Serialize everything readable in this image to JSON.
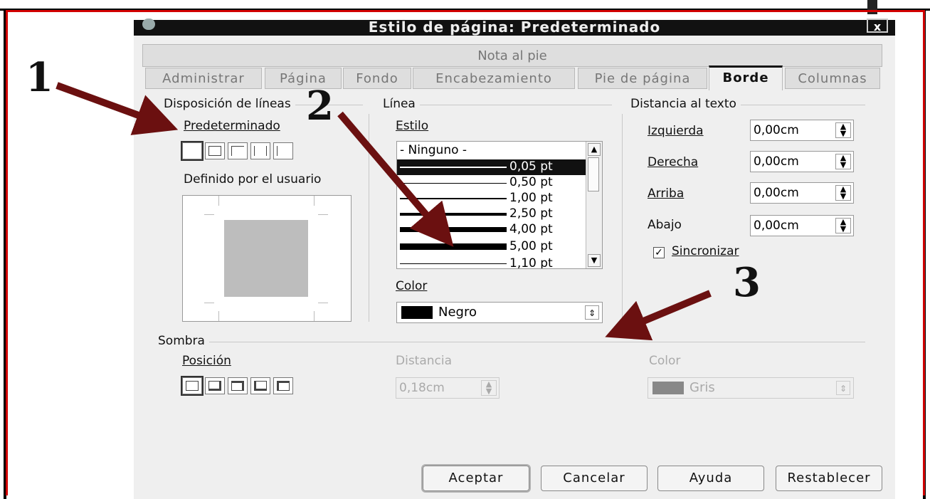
{
  "dialog": {
    "title": "Estilo de página: Predeterminado",
    "close": "x"
  },
  "tabs": {
    "top_row": "Nota al pie",
    "items": [
      {
        "label": "Administrar"
      },
      {
        "label": "Página"
      },
      {
        "label": "Fondo"
      },
      {
        "label": "Encabezamiento"
      },
      {
        "label": "Pie de página"
      },
      {
        "label": "Borde"
      },
      {
        "label": "Columnas"
      }
    ],
    "active": "Borde"
  },
  "line_arrangement": {
    "heading": "Disposición de líneas",
    "default_label": "Predeterminado",
    "user_label": "Definido por el usuario"
  },
  "line": {
    "heading": "Línea",
    "style_label": "Estilo",
    "styles": [
      {
        "label": "- Ninguno -"
      },
      {
        "label": "0,05 pt"
      },
      {
        "label": "0,50 pt"
      },
      {
        "label": "1,00 pt"
      },
      {
        "label": "2,50 pt"
      },
      {
        "label": "4,00 pt"
      },
      {
        "label": "5,00 pt"
      },
      {
        "label": "1,10 pt"
      }
    ],
    "selected_style": "0,05 pt",
    "color_label": "Color",
    "color_value": "Negro",
    "color_swatch": "#000000"
  },
  "spacing": {
    "heading": "Distancia al texto",
    "left_label": "Izquierda",
    "left_value": "0,00cm",
    "right_label": "Derecha",
    "right_value": "0,00cm",
    "top_label": "Arriba",
    "top_value": "0,00cm",
    "bottom_label": "Abajo",
    "bottom_value": "0,00cm",
    "sync_label": "Sincronizar",
    "sync_checked": true
  },
  "shadow": {
    "heading": "Sombra",
    "position_label": "Posición",
    "distance_label": "Distancia",
    "distance_value": "0,18cm",
    "color_label": "Color",
    "color_value": "Gris",
    "color_swatch": "#888888"
  },
  "buttons": {
    "ok": "Aceptar",
    "cancel": "Cancelar",
    "help": "Ayuda",
    "reset": "Restablecer"
  },
  "annotations": {
    "one": "1",
    "two": "2",
    "three": "3",
    "arrow_color": "#6b1010"
  }
}
